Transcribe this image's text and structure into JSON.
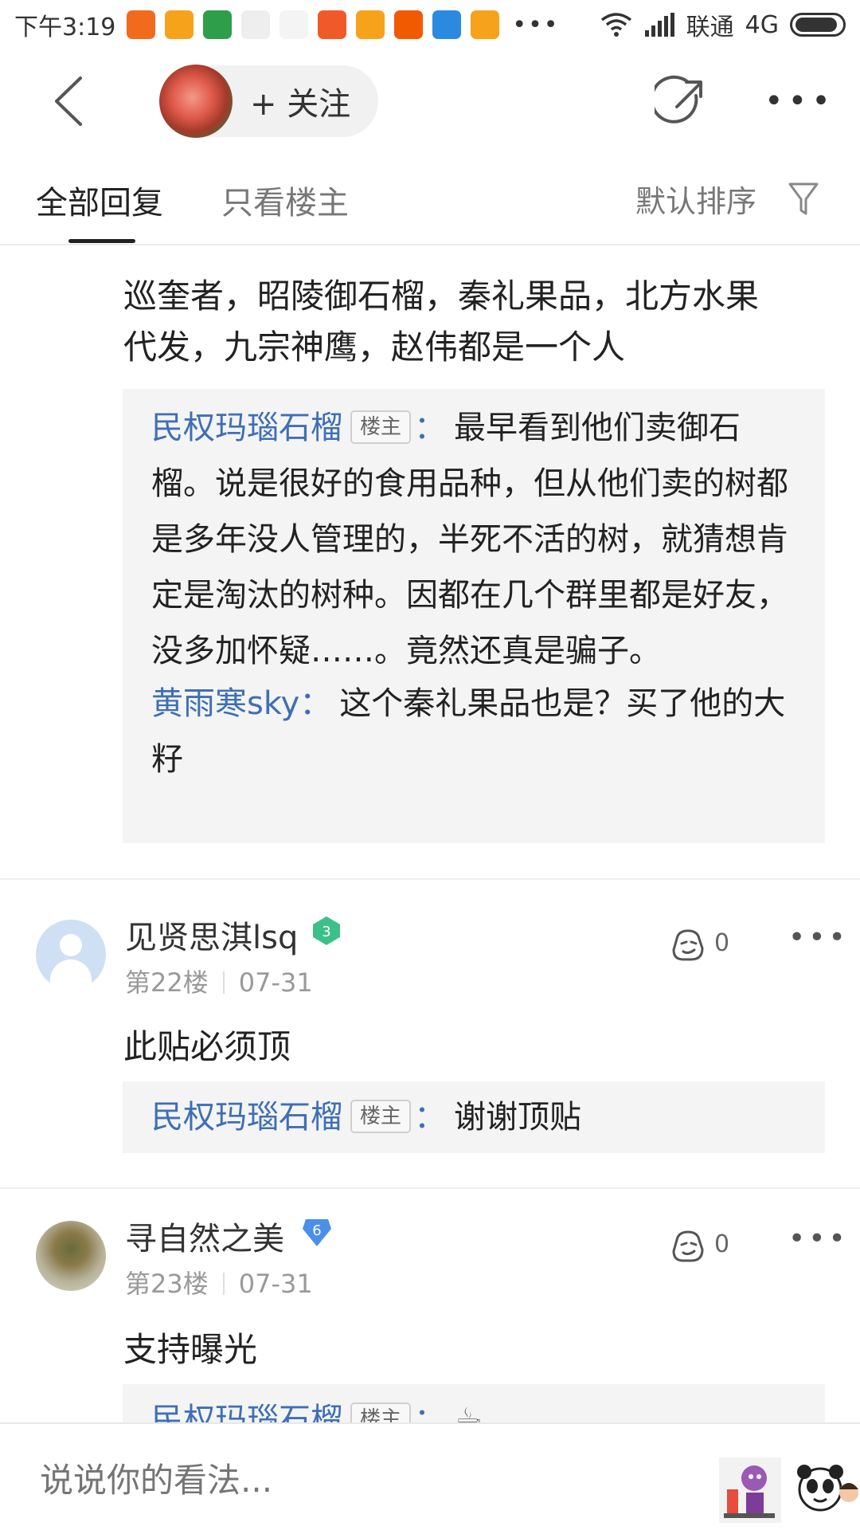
{
  "status_bar": {
    "time": "下午3:19",
    "dots": "•••",
    "carrier": "联通",
    "network": "4G",
    "app_icons": [
      {
        "name": "app-icon-1",
        "color": "#f26b1d"
      },
      {
        "name": "app-icon-2",
        "color": "#f7a21b"
      },
      {
        "name": "app-icon-3",
        "color": "#2e9e4b"
      },
      {
        "name": "app-icon-4",
        "color": "#ffffff"
      },
      {
        "name": "app-icon-5",
        "color": "#ffffff"
      },
      {
        "name": "app-icon-6",
        "color": "#f05a28"
      },
      {
        "name": "app-icon-7",
        "color": "#f7a21b"
      },
      {
        "name": "app-icon-8",
        "color": "#f25a00"
      },
      {
        "name": "app-icon-9",
        "color": "#2b8ae0"
      },
      {
        "name": "app-icon-10",
        "color": "#f7a21b"
      }
    ]
  },
  "header": {
    "follow_label": "+ 关注"
  },
  "tabs": {
    "all_replies": "全部回复",
    "owner_only": "只看楼主",
    "sort": "默认排序"
  },
  "post": {
    "text_line1": "巡奎者，昭陵御石榴，秦礼果品，北方水果",
    "text_line2": "代发，九宗神鹰，赵伟都是一个人",
    "sub_replies": [
      {
        "user": "民权玛瑙石榴",
        "tag": "楼主",
        "colon": "：",
        "text": "最早看到他们卖御石榴。说是很好的食用品种，但从他们卖的树都是多年没人管理的，半死不活的树，就猜想肯定是淘汰的树种。因都在几个群里都是好友，没多加怀疑……。竟然还真是骗子。"
      },
      {
        "user": "黄雨寒sky",
        "colon": "：",
        "text": "这个秦礼果品也是？买了他的大籽"
      }
    ]
  },
  "replies": [
    {
      "user": "见贤思淇lsq",
      "level": "3",
      "level_color": "#3cc08a",
      "floor": "第22楼",
      "date": "07-31",
      "likes": "0",
      "text": "此贴必须顶",
      "sub_user": "民权玛瑙石榴",
      "sub_tag": "楼主",
      "sub_colon": "：",
      "sub_text": "谢谢顶贴"
    },
    {
      "user": "寻自然之美",
      "level": "6",
      "level_color": "#4a8fe8",
      "floor": "第23楼",
      "date": "07-31",
      "likes": "0",
      "text": "支持曝光",
      "sub_user": "民权玛瑙石榴",
      "sub_tag": "楼主",
      "sub_colon": "：",
      "sub_text": "☕"
    }
  ],
  "bottom": {
    "placeholder": "说说你的看法..."
  },
  "colors": {
    "link_blue": "#3f6fb5",
    "quote_bg": "#f4f4f4"
  }
}
